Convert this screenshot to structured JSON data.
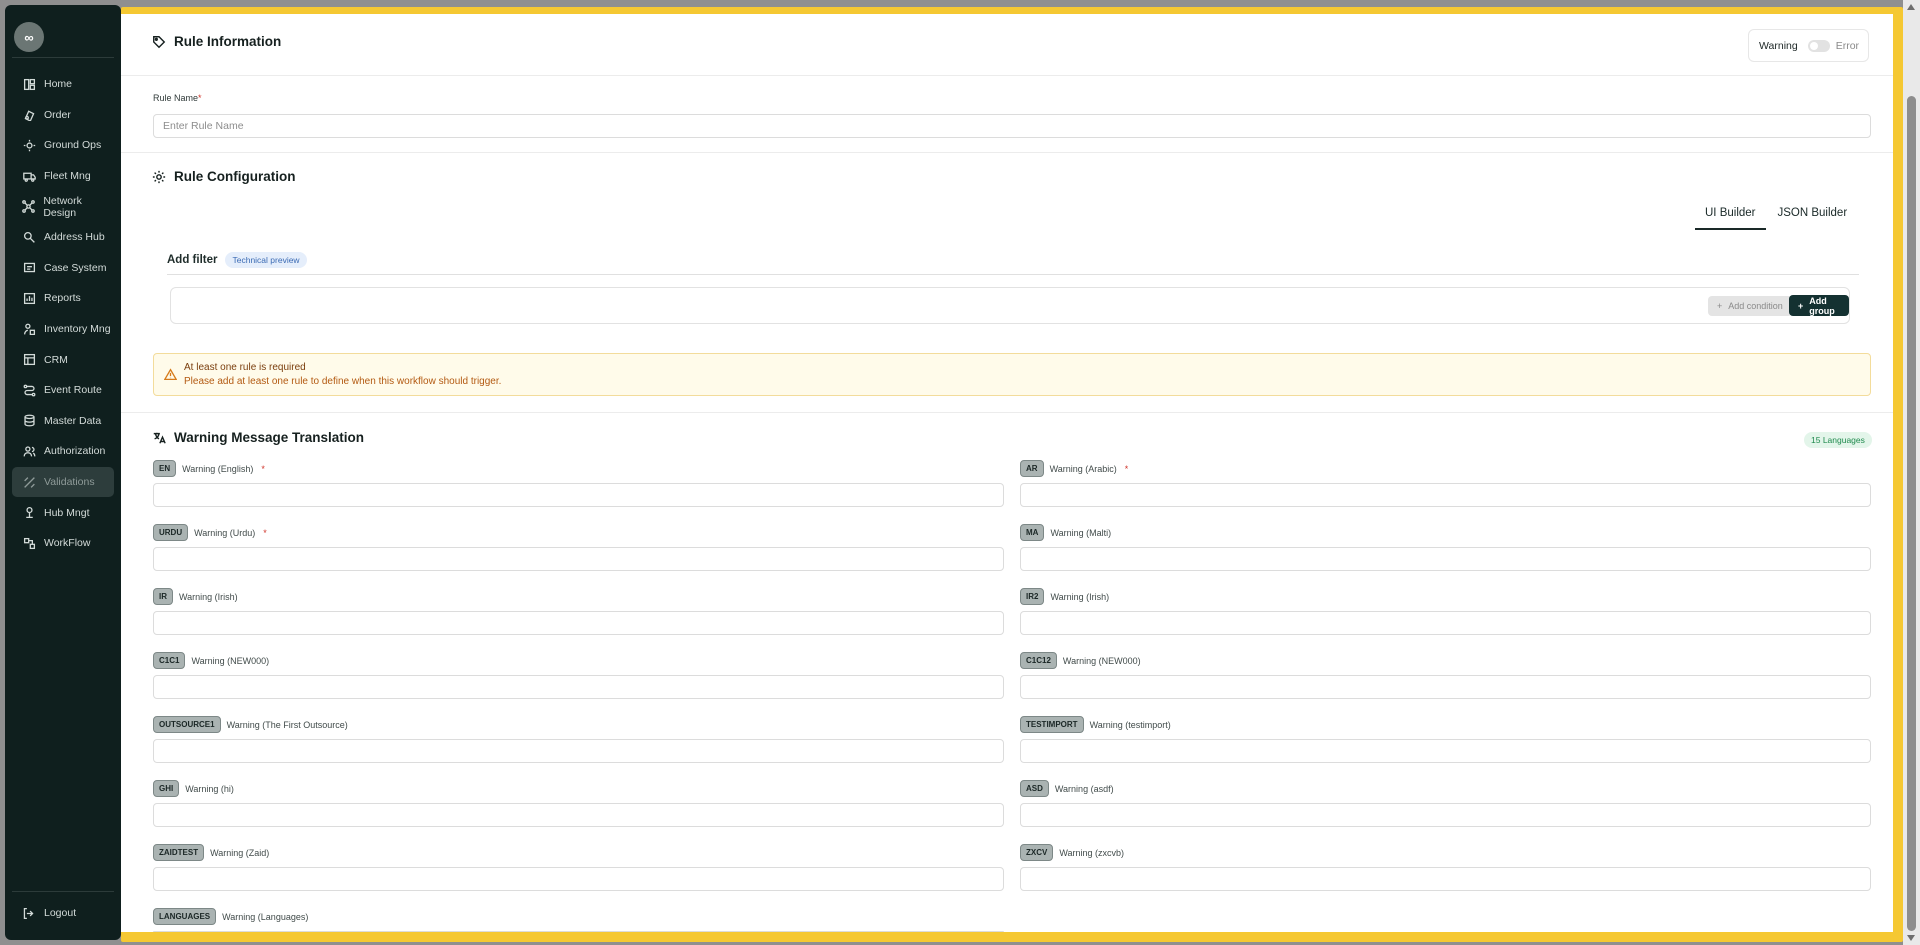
{
  "sidebar": {
    "logo_text": "∞",
    "items": [
      {
        "label": "Home",
        "icon": "home-icon"
      },
      {
        "label": "Order",
        "icon": "order-icon"
      },
      {
        "label": "Ground Ops",
        "icon": "ground-ops-icon"
      },
      {
        "label": "Fleet Mng",
        "icon": "truck-icon"
      },
      {
        "label": "Network Design",
        "icon": "network-icon"
      },
      {
        "label": "Address Hub",
        "icon": "location-icon"
      },
      {
        "label": "Case System",
        "icon": "case-icon"
      },
      {
        "label": "Reports",
        "icon": "report-icon"
      },
      {
        "label": "Inventory Mng",
        "icon": "inventory-icon"
      },
      {
        "label": "CRM",
        "icon": "crm-icon"
      },
      {
        "label": "Event Route",
        "icon": "route-icon"
      },
      {
        "label": "Master Data",
        "icon": "database-icon"
      },
      {
        "label": "Authorization",
        "icon": "users-icon"
      },
      {
        "label": "Validations",
        "icon": "validation-icon",
        "active": true
      },
      {
        "label": "Hub Mngt",
        "icon": "hub-icon"
      },
      {
        "label": "WorkFlow",
        "icon": "workflow-icon"
      }
    ],
    "logout_label": "Logout"
  },
  "rule_info": {
    "title": "Rule Information",
    "toggle_warning": "Warning",
    "toggle_error": "Error",
    "rule_name_label": "Rule Name",
    "required_mark": "*",
    "rule_name_placeholder": "Enter Rule Name"
  },
  "rule_config": {
    "title": "Rule Configuration",
    "tabs": [
      "UI Builder",
      "JSON Builder"
    ],
    "add_filter": "Add filter",
    "technical_preview": "Technical preview",
    "add_condition": "Add condition",
    "add_group": "Add group"
  },
  "alert": {
    "title": "At least one rule is required",
    "message": "Please add at least one rule to define when this workflow should trigger."
  },
  "translation": {
    "title": "Warning Message Translation",
    "count": "15 Languages",
    "languages": [
      {
        "code": "EN",
        "label": "Warning (English)",
        "required": true
      },
      {
        "code": "AR",
        "label": "Warning (Arabic)",
        "required": true
      },
      {
        "code": "URDU",
        "label": "Warning (Urdu)",
        "required": true
      },
      {
        "code": "MA",
        "label": "Warning (Malti)",
        "required": false
      },
      {
        "code": "IR",
        "label": "Warning (Irish)",
        "required": false
      },
      {
        "code": "IR2",
        "label": "Warning (Irish)",
        "required": false
      },
      {
        "code": "C1C1",
        "label": "Warning (NEW000)",
        "required": false
      },
      {
        "code": "C1C12",
        "label": "Warning (NEW000)",
        "required": false
      },
      {
        "code": "OUTSOURCE1",
        "label": "Warning (The First Outsource)",
        "required": false
      },
      {
        "code": "TESTIMPORT",
        "label": "Warning (testimport)",
        "required": false
      },
      {
        "code": "GHI",
        "label": "Warning (hi)",
        "required": false
      },
      {
        "code": "ASD",
        "label": "Warning (asdf)",
        "required": false
      },
      {
        "code": "ZAIDTEST",
        "label": "Warning (Zaid)",
        "required": false
      },
      {
        "code": "ZXCV",
        "label": "Warning (zxcvb)",
        "required": false
      },
      {
        "code": "LANGUAGES",
        "label": "Warning (Languages)",
        "required": false
      }
    ]
  }
}
